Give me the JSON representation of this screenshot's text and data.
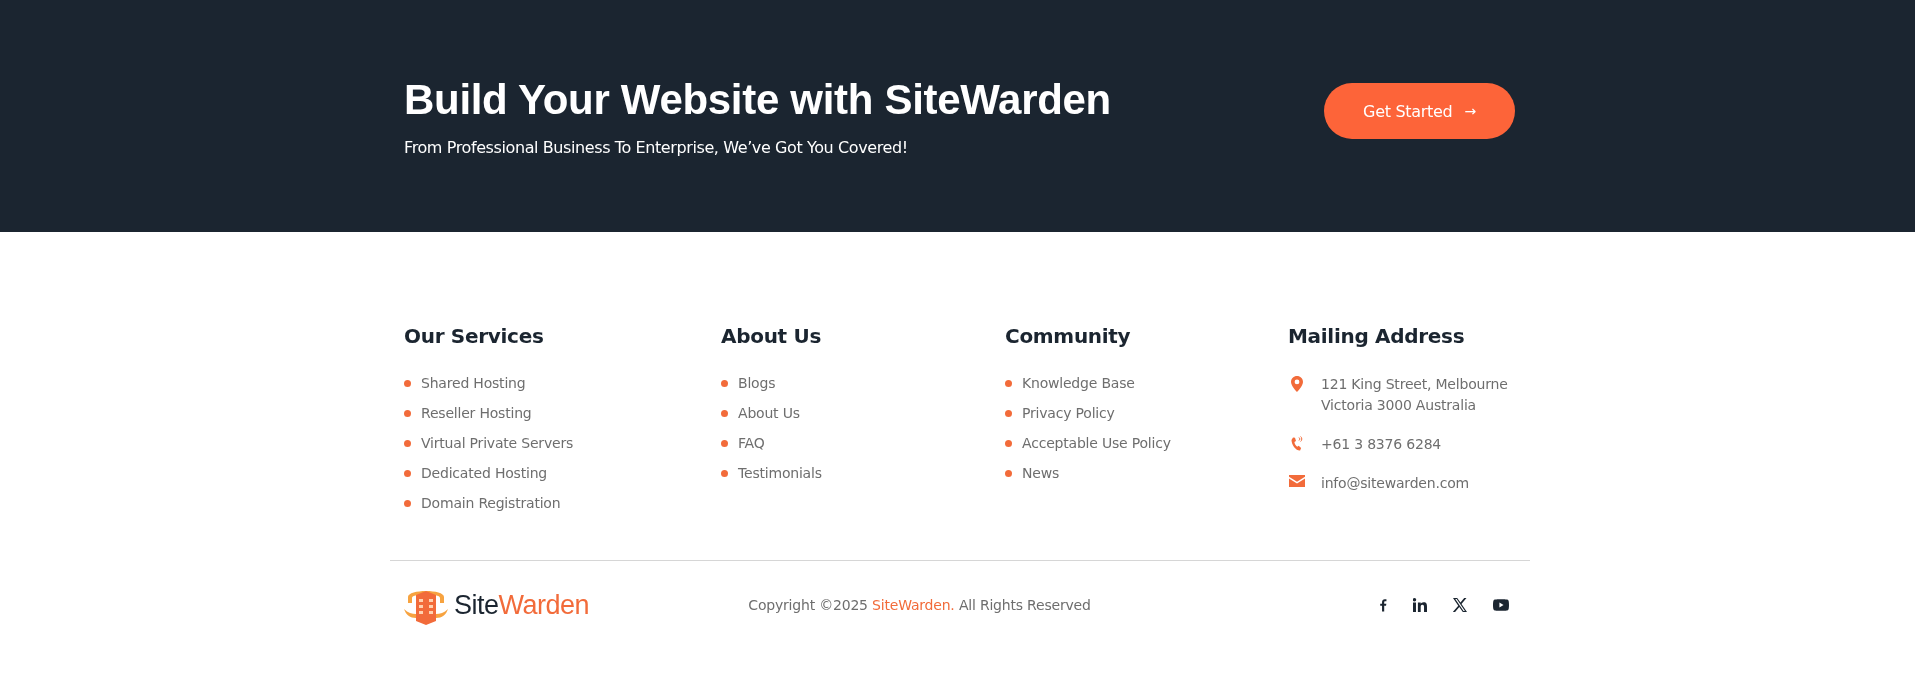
{
  "banner": {
    "title": "Build Your Website with SiteWarden",
    "subtitle": "From Professional Business To Enterprise, We’ve Got You Covered!",
    "button": {
      "label": "Get Started",
      "icon": "→"
    }
  },
  "columns": [
    {
      "heading": "Our Services",
      "links": [
        "Shared Hosting",
        "Reseller Hosting",
        "Virtual Private Servers",
        "Dedicated Hosting",
        "Domain Registration"
      ]
    },
    {
      "heading": "About Us",
      "links": [
        "Blogs",
        "About Us",
        "FAQ",
        "Testimonials"
      ]
    },
    {
      "heading": "Community",
      "links": [
        "Knowledge Base",
        "Privacy Policy",
        "Acceptable Use Policy",
        "News"
      ]
    }
  ],
  "contact": {
    "heading": "Mailing Address",
    "items": [
      {
        "kind": "location",
        "text": "121 King Street, Melbourne\nVictoria 3000 Australia"
      },
      {
        "kind": "phone",
        "text": "+61 3 8376 6284"
      },
      {
        "kind": "email",
        "text": "info@sitewarden.com"
      }
    ]
  },
  "bottom": {
    "logo": {
      "first": "Site",
      "second": "Warden"
    },
    "copyright": {
      "before": "Copyright ©2025 ",
      "link": "SiteWarden.",
      "after": " All Rights Reserved"
    },
    "social": [
      {
        "kind": "facebook"
      },
      {
        "kind": "linkedin"
      },
      {
        "kind": "x"
      },
      {
        "kind": "youtube"
      }
    ]
  }
}
